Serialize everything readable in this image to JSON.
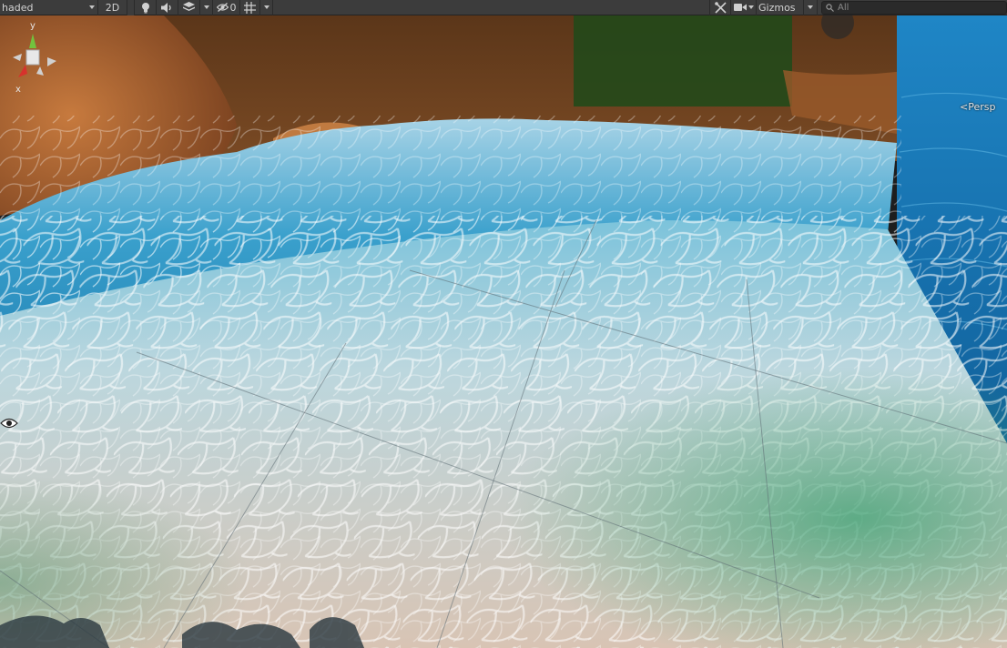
{
  "toolbar": {
    "shading_mode": "haded",
    "mode_2d": "2D",
    "hidden_count": "0",
    "gizmos_label": "Gizmos",
    "search_placeholder": "All"
  },
  "scene": {
    "gizmo_axes": {
      "y": "y",
      "x": "x"
    },
    "projection_label": "<Persp"
  },
  "icons": [
    "lightbulb-icon",
    "audio-icon",
    "effects-icon",
    "visibility-icon",
    "grid-icon",
    "tools-icon",
    "camera-icon",
    "search-icon",
    "scene-eye-icon"
  ],
  "colors": {
    "toolbar": "#3c3c3c",
    "gizmo_x": "#d6322c",
    "gizmo_y": "#72c23e",
    "gizmo_z": "#3a74d4"
  }
}
